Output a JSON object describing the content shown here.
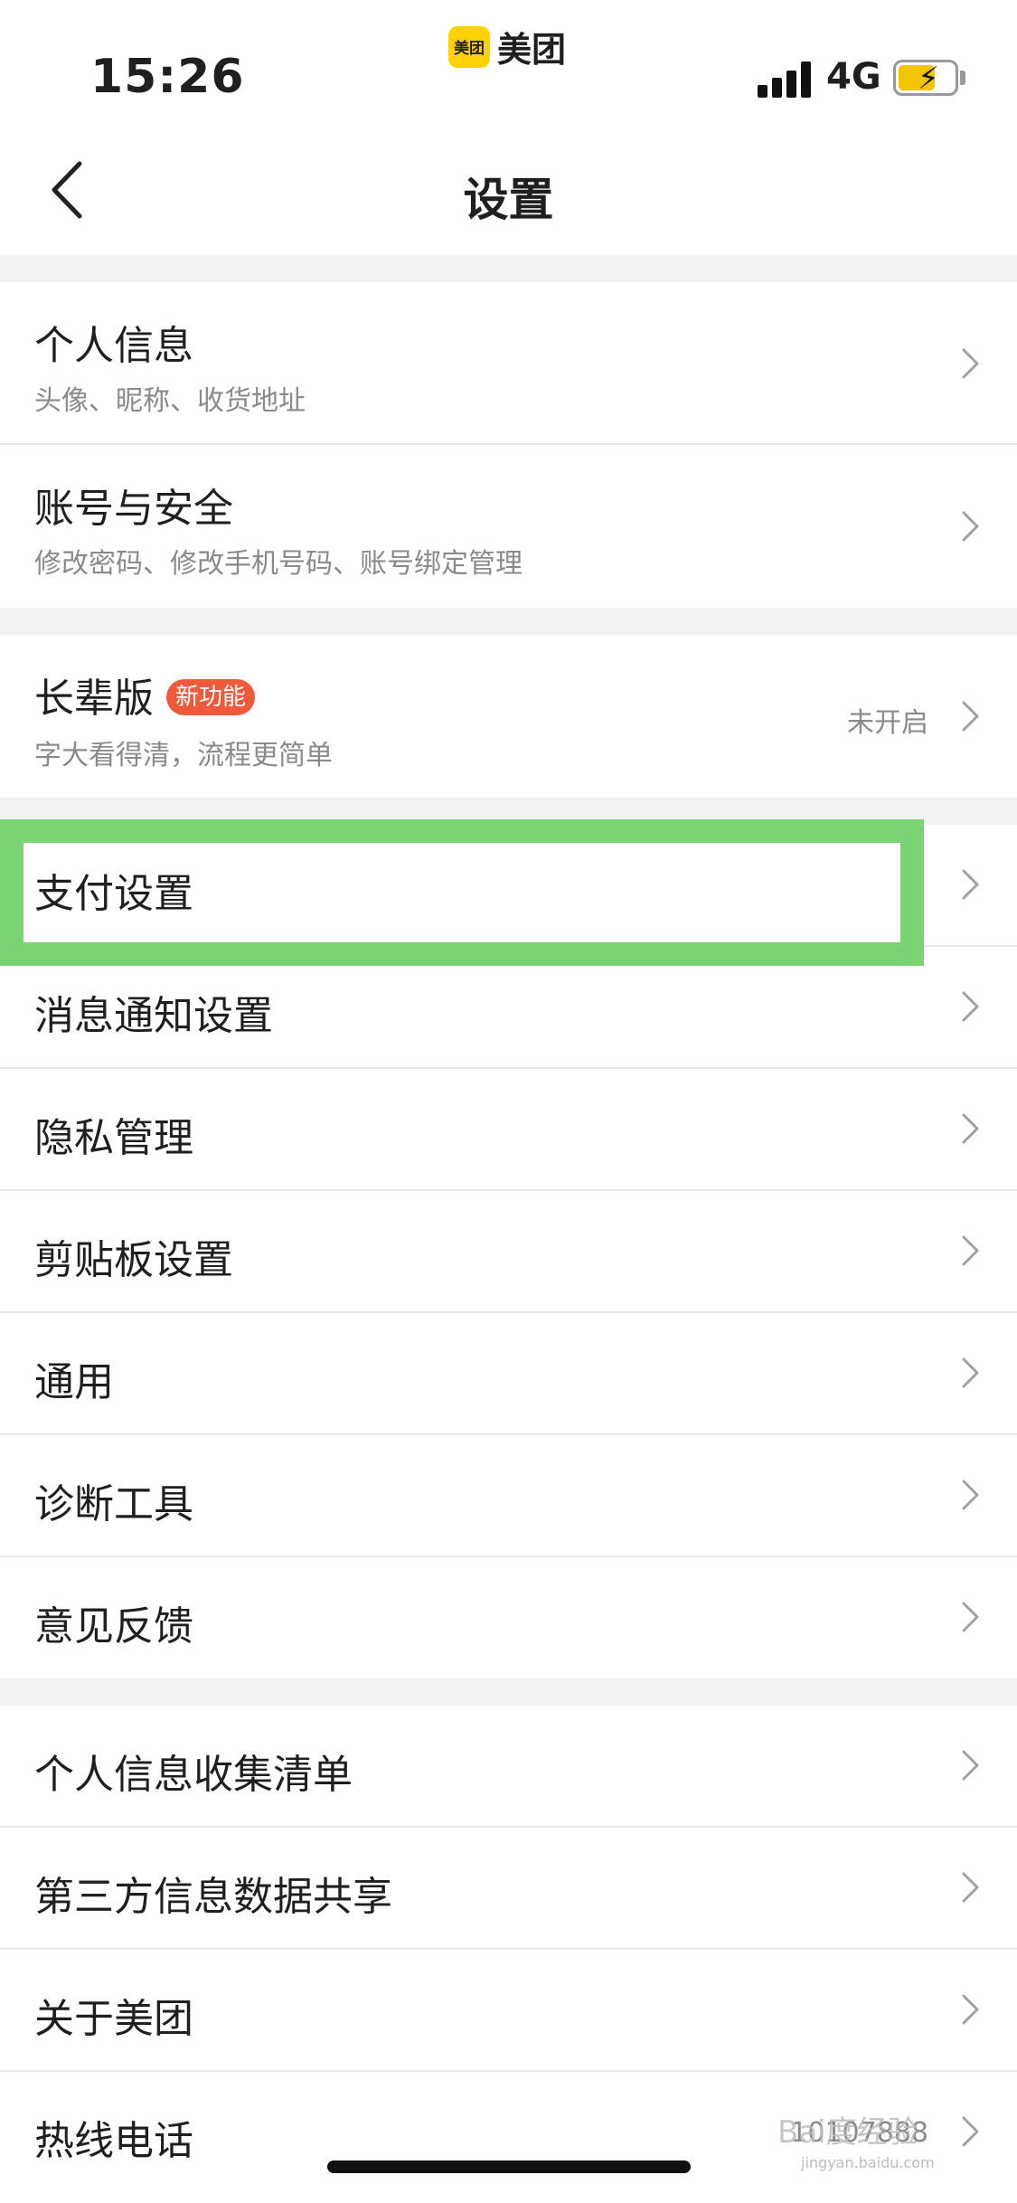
{
  "status_bar": {
    "time": "15:26",
    "app_logo_text": "美团",
    "app_name": "美团",
    "network": "4G"
  },
  "nav": {
    "title": "设置",
    "back_icon": "chevron-left-icon"
  },
  "groups": [
    {
      "rows": [
        {
          "title": "个人信息",
          "subtitle": "头像、昵称、收货地址"
        },
        {
          "title": "账号与安全",
          "subtitle": "修改密码、修改手机号码、账号绑定管理"
        }
      ]
    },
    {
      "rows": [
        {
          "title": "长辈版",
          "tag": "新功能",
          "subtitle": "字大看得清，流程更简单",
          "value": "未开启"
        }
      ]
    },
    {
      "rows": [
        {
          "title": "支付设置"
        },
        {
          "title": "消息通知设置"
        },
        {
          "title": "隐私管理"
        },
        {
          "title": "剪贴板设置"
        },
        {
          "title": "通用"
        },
        {
          "title": "诊断工具"
        },
        {
          "title": "意见反馈"
        }
      ]
    },
    {
      "rows": [
        {
          "title": "个人信息收集清单"
        },
        {
          "title": "第三方信息数据共享"
        },
        {
          "title": "关于美团"
        },
        {
          "title": "热线电话",
          "value": "10107888"
        }
      ]
    }
  ],
  "colors": {
    "highlight": "#7bd474",
    "tag_bg": "#f05a3a",
    "brand": "#ffd100"
  },
  "watermark": {
    "main": "Bai度经验",
    "sub": "jingyan.baidu.com"
  }
}
